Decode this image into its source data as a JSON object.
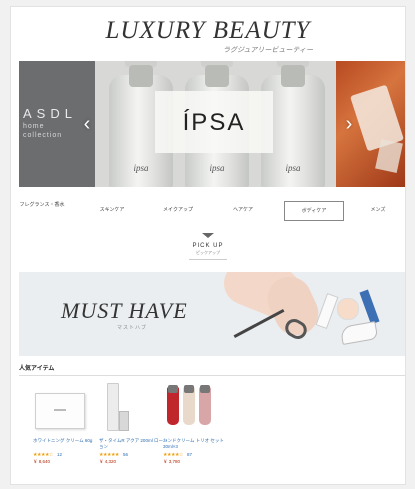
{
  "header": {
    "title": "LUXURY BEAUTY",
    "subtitle": "ラグジュアリービューティー"
  },
  "carousel": {
    "left_slide": {
      "brand": "ASDL",
      "line1": "home",
      "line2": "collection"
    },
    "main_slide": {
      "logo": "ÍPSA",
      "bottle_labels": [
        "ipsa",
        "ipsa",
        "ipsa"
      ]
    },
    "prev_arrow": "‹",
    "next_arrow": "›"
  },
  "categories": [
    {
      "label": "フレグランス・香水"
    },
    {
      "label": "スキンケア"
    },
    {
      "label": "メイクアップ"
    },
    {
      "label": "ヘアケア"
    },
    {
      "label": "ボディケア"
    },
    {
      "label": "メンズ"
    }
  ],
  "pickup": {
    "label": "PICK UP",
    "sub": "ピックアップ"
  },
  "banner": {
    "title": "MUST HAVE",
    "sub": "マストハブ"
  },
  "popular": {
    "heading": "人気アイテム",
    "items": [
      {
        "title": "ホワイトニング クリーム 60g",
        "stars": "★★★★☆",
        "reviews": "12",
        "price": "￥ 8,640"
      },
      {
        "title": "ザ・タイムR アクア 200ml ローション",
        "stars": "★★★★★",
        "reviews": "56",
        "price": "￥ 4,320"
      },
      {
        "title": "ハンドクリーム トリオ セット 30ml×3",
        "stars": "★★★★☆",
        "reviews": "87",
        "price": "￥ 3,780"
      }
    ]
  },
  "colors": {
    "page_bg": "#f1f1f1",
    "link": "#2b6cb0",
    "star": "#f29d00",
    "price": "#b12704",
    "slide_left": "#6c6d6f",
    "slide_right": "#b74a22"
  }
}
